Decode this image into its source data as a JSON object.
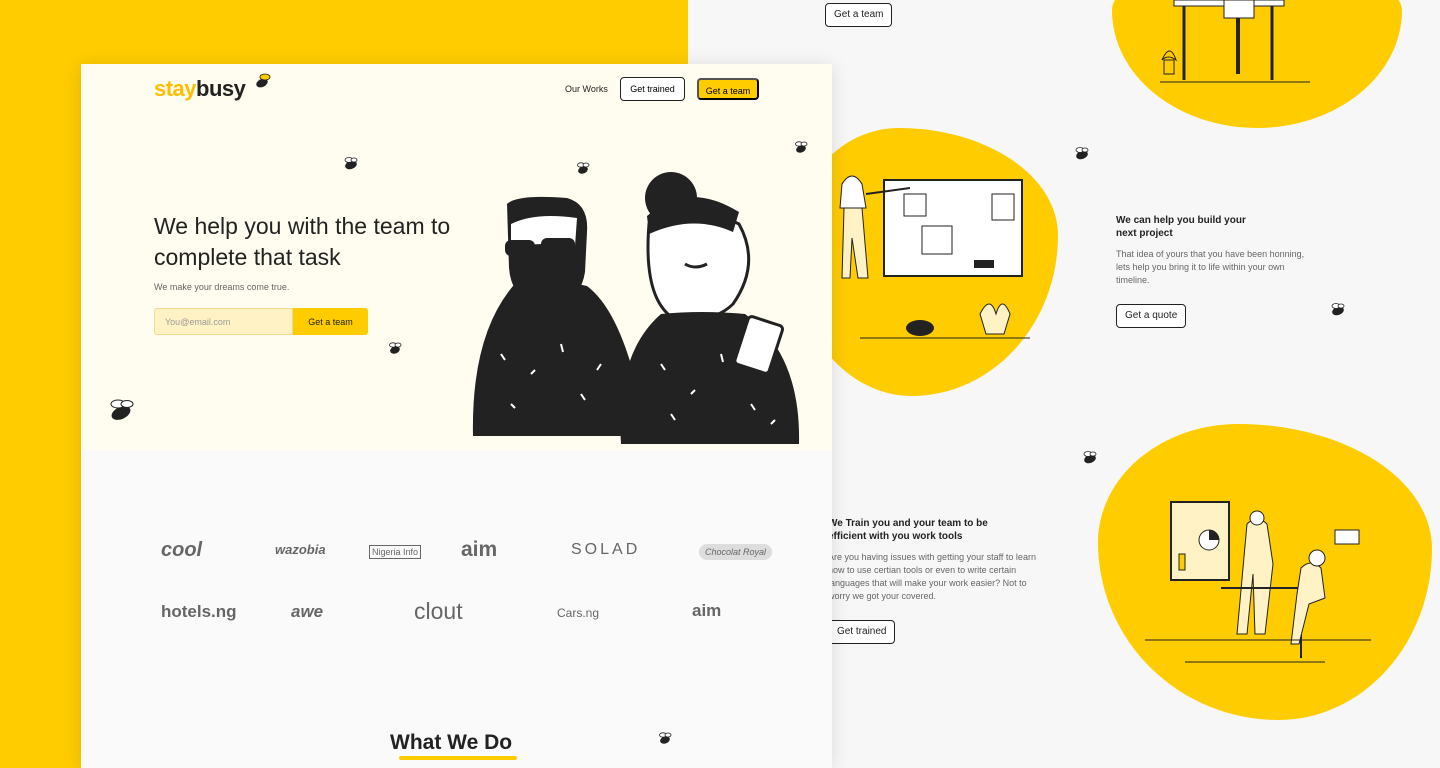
{
  "brand": {
    "logo_part1": "stay",
    "logo_part2": "busy"
  },
  "nav": {
    "our_works": "Our Works",
    "get_trained": "Get trained",
    "get_a_team": "Get a team"
  },
  "hero": {
    "title": "We help you with the team to complete that task",
    "subtitle": "We make your dreams come true.",
    "email_placeholder": "You@email.com",
    "cta": "Get a team"
  },
  "clients": [
    "cool",
    "wazobia",
    "Nigeria Info",
    "aim",
    "SOLAD",
    "Chocolat Royal",
    "hotels.ng",
    "awe",
    "clout",
    "Cars.ng",
    "aim"
  ],
  "what_we_do": {
    "title": "What We Do"
  },
  "services": [
    {
      "cta": "Get a team"
    },
    {
      "heading": "We can help you build your next project",
      "text": "That idea of yours that you have been honning, lets help you bring it to life within your own timeline.",
      "cta": "Get a quote"
    },
    {
      "heading": "We Train you and your team to be efficient with you work tools",
      "text": "Are you having issues with getting your staff to learn how to use certian tools or even to write certain languages that will make your work easier? Not to worry we got your covered.",
      "cta": "Get trained"
    }
  ],
  "colors": {
    "accent": "#ffcc00",
    "ink": "#222222",
    "hero_bg": "#fffdf0",
    "page_bg": "#fafafa"
  },
  "icons": [
    "bee-icon",
    "people-illustration",
    "board-illustration",
    "presentation-illustration",
    "desk-illustration"
  ]
}
